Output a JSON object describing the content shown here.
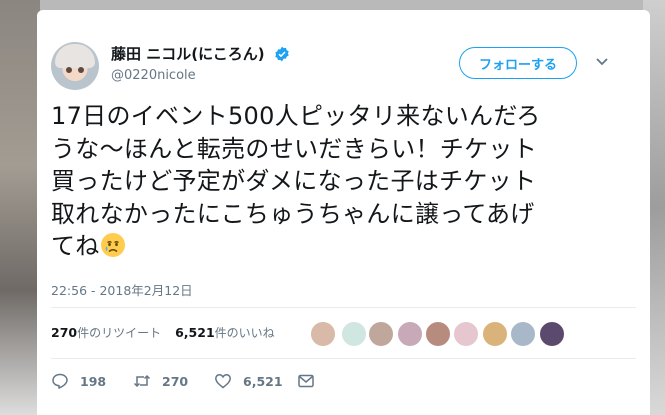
{
  "user": {
    "display_name": "藤田 ニコル(にころん)",
    "handle": "@0220nicole"
  },
  "follow_button": {
    "label": "フォローする"
  },
  "tweet": {
    "text_lines": [
      "17日のイベント500人ピッタリ来ないんだろ",
      "うな〜ほんと転売のせいだきらい！チケット",
      "買ったけど予定がダメになった子はチケット",
      "取れなかったにこちゅうちゃんに譲ってあげ",
      "てね"
    ],
    "emoji": "crying-face",
    "timestamp": "22:56 - 2018年2月12日"
  },
  "stats": {
    "retweets_count": "270",
    "retweets_label": "件のリツイート",
    "likes_count": "6,521",
    "likes_label": "件のいいね"
  },
  "likers": {
    "avatar_colors": [
      "#d9b9a8",
      "#cfe6e1",
      "#bfa79c",
      "#c8a9b8",
      "#b88b7f",
      "#e6c6cf",
      "#d9b37a",
      "#a9b8c8",
      "#5b4a6e"
    ]
  },
  "actions": {
    "replies": "198",
    "retweets": "270",
    "likes": "6,521"
  },
  "colors": {
    "accent": "#1da1f2",
    "text": "#14171a",
    "muted": "#657786"
  }
}
